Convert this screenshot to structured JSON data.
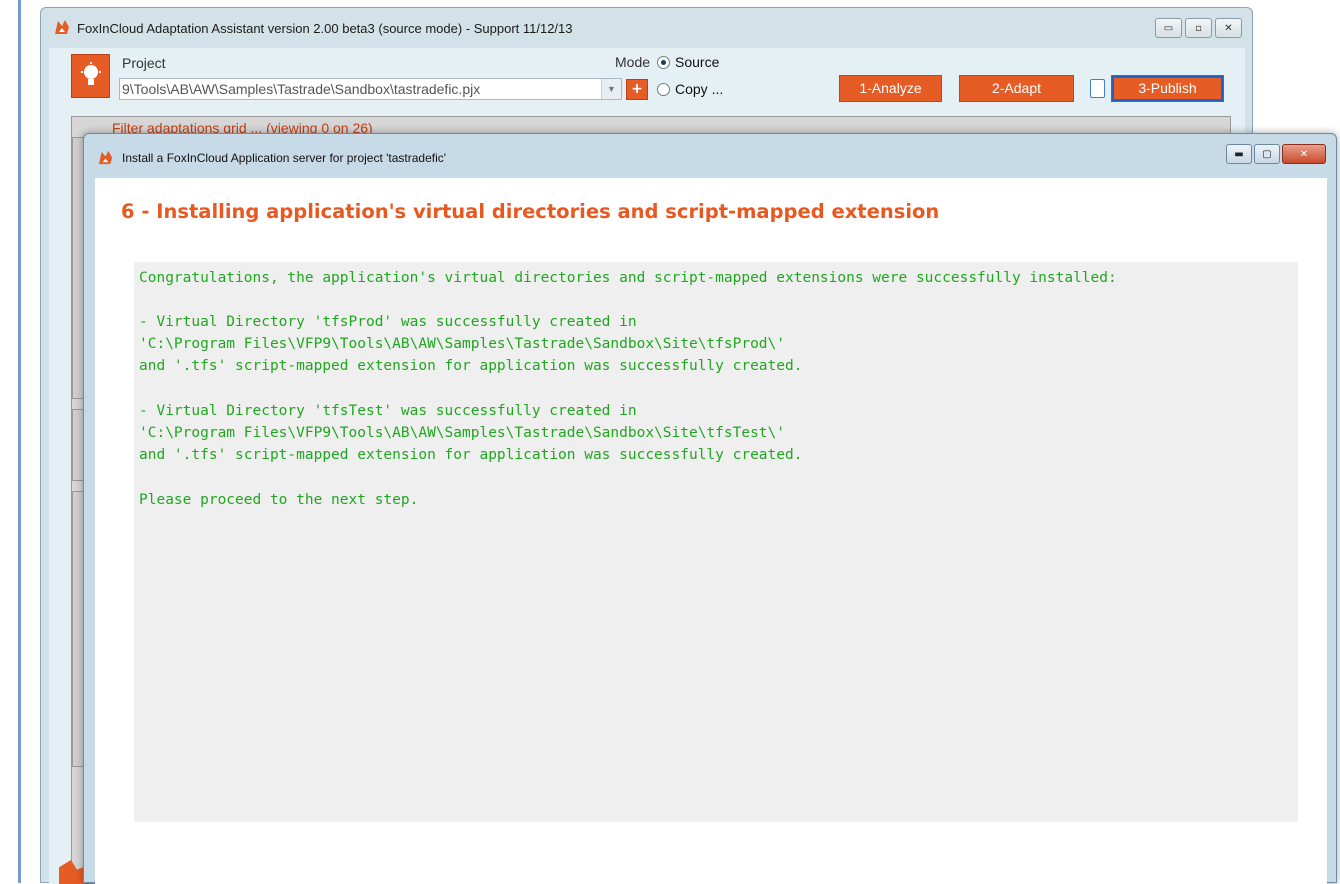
{
  "main_window": {
    "title": "FoxInCloud Adaptation Assistant version 2.00 beta3 (source mode) - Support 11/12/13",
    "caption": {
      "minimize": "▭",
      "maximize": "▫",
      "close": "✕"
    },
    "project_label": "Project",
    "project_path": "9\\Tools\\AB\\AW\\Samples\\Tastrade\\Sandbox\\tastradefic.pjx",
    "plus_label": "+",
    "mode_label": "Mode",
    "mode_options": [
      "Source",
      "Copy ..."
    ],
    "buttons": {
      "analyze": "1-Analyze",
      "adapt": "2-Adapt",
      "publish": "3-Publish"
    },
    "filter_text": "Filter adaptations grid ... (viewing 0 on 26)"
  },
  "dialog": {
    "title": "Install a FoxInCloud Application server for project 'tastradefic'",
    "caption": {
      "minimize": "▬",
      "maximize": "▢",
      "close": "✕"
    },
    "heading": "6 - Installing application's virtual directories and script-mapped extension",
    "messages": [
      "Congratulations, the application's virtual directories and script-mapped extensions were successfully installed:",
      "- Virtual Directory 'tfsProd' was successfully created in",
      "'C:\\Program Files\\VFP9\\Tools\\AB\\AW\\Samples\\Tastrade\\Sandbox\\Site\\tfsProd\\'",
      "and '.tfs' script-mapped extension for application was successfully created.",
      "- Virtual Directory 'tfsTest' was successfully created in",
      "'C:\\Program Files\\VFP9\\Tools\\AB\\AW\\Samples\\Tastrade\\Sandbox\\Site\\tfsTest\\'",
      "and '.tfs' script-mapped extension for application was successfully created.",
      "Please proceed to the next step."
    ]
  },
  "colors": {
    "accent_orange": "#e65c25",
    "message_green": "#1fa71f",
    "heading_orange": "#e8581f"
  }
}
